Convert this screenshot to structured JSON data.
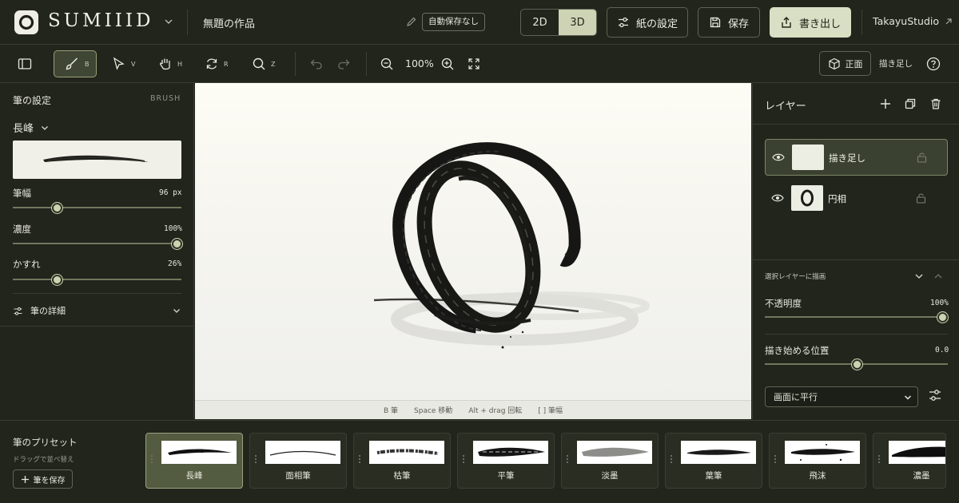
{
  "app": {
    "brand": "SUMIIID",
    "doc_title": "無題の作品",
    "autosave": "自動保存なし"
  },
  "mode": {
    "options": [
      "2D",
      "3D"
    ],
    "active": "3D"
  },
  "top_buttons": {
    "paper": "紙の設定",
    "save": "保存",
    "export": "書き出し",
    "studio": "TakayuStudio"
  },
  "toolbar": {
    "tools": [
      {
        "name": "brush",
        "key": "B"
      },
      {
        "name": "select",
        "key": "V"
      },
      {
        "name": "hand",
        "key": "H"
      },
      {
        "name": "rotate",
        "key": "R"
      },
      {
        "name": "zoom",
        "key": "Z"
      }
    ],
    "zoom": "100%",
    "view_front": "正面",
    "current_layer": "描き足し"
  },
  "brush_panel": {
    "title": "筆の設定",
    "tag": "BRUSH",
    "brush_name": "長峰",
    "sliders": [
      {
        "label": "筆幅",
        "value": "96 px",
        "level": 0.26
      },
      {
        "label": "濃度",
        "value": "100%",
        "level": 1.0
      },
      {
        "label": "かすれ",
        "value": "26%",
        "level": 0.26
      }
    ],
    "details": "筆の詳細"
  },
  "canvas_hints": [
    "B 筆",
    "Space 移動",
    "Alt + drag 回転",
    "[ ] 筆幅"
  ],
  "layers_panel": {
    "title": "レイヤー",
    "layers": [
      {
        "name": "描き足し",
        "selected": true
      },
      {
        "name": "円相",
        "selected": false
      }
    ],
    "draw_on_selected": "選択レイヤーに描画",
    "opacity": {
      "label": "不透明度",
      "value": "100%",
      "level": 1.0
    },
    "start_pos": {
      "label": "描き始める位置",
      "value": "0.0",
      "level": 0.5
    },
    "plane_select": "画面に平行"
  },
  "presets_panel": {
    "title": "筆のプリセット",
    "subtitle": "ドラッグで並べ替え",
    "save_button": "筆を保存",
    "presets": [
      "長峰",
      "面相筆",
      "枯筆",
      "平筆",
      "淡墨",
      "葉筆",
      "飛沫",
      "濃墨"
    ],
    "selected": "長峰"
  },
  "colors": {
    "bg": "#22251c",
    "accent": "#cdd3b4",
    "ink": "#1a1a16",
    "paper": "#fdfcf5"
  }
}
